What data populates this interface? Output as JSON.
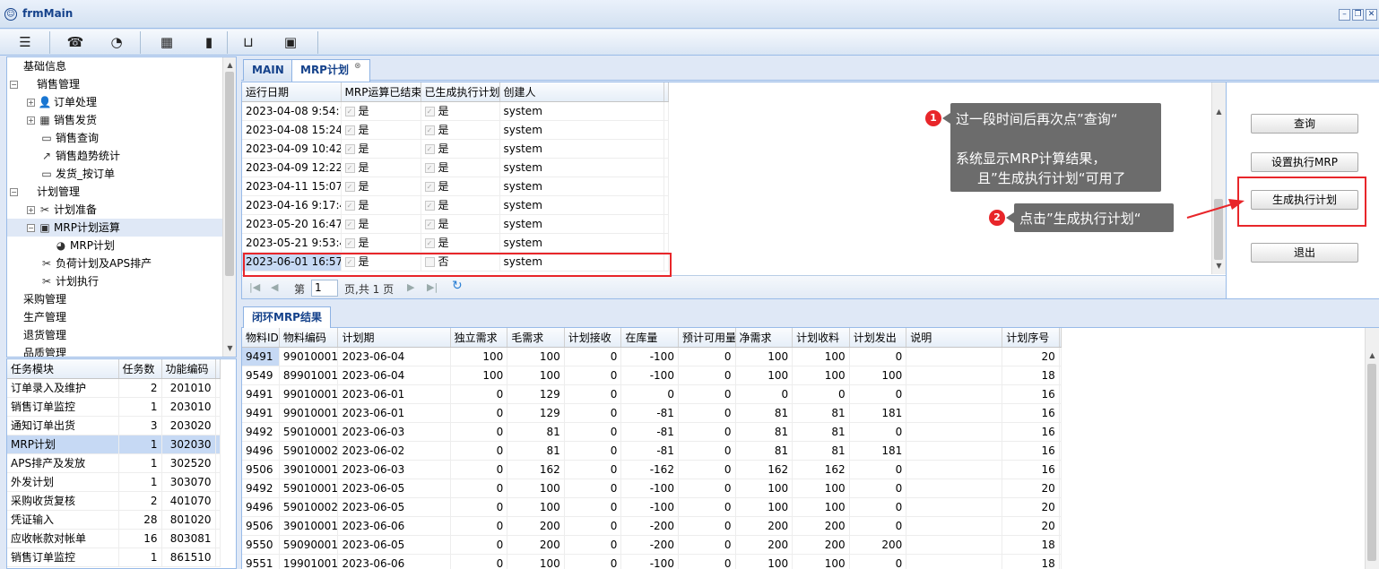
{
  "window": {
    "title": "frmMain",
    "controls": [
      "minimize-button",
      "restore-button",
      "close-button"
    ]
  },
  "toolbar": {
    "icons": [
      "menu-icon",
      "phone-icon",
      "rss-icon",
      "calendar-icon",
      "bookmark-icon",
      "inbox-icon",
      "image-icon"
    ]
  },
  "tree": {
    "items": [
      {
        "label": "基础信息",
        "indent": 0,
        "toggle": "",
        "icon": ""
      },
      {
        "label": "销售管理",
        "indent": 0,
        "toggle": "⊟",
        "icon": ""
      },
      {
        "label": "订单处理",
        "indent": 1,
        "toggle": "⊞",
        "icon": "user-icon"
      },
      {
        "label": "销售发货",
        "indent": 1,
        "toggle": "⊞",
        "icon": "calendar-icon"
      },
      {
        "label": "销售查询",
        "indent": 1,
        "toggle": "",
        "icon": "monitor-icon"
      },
      {
        "label": "销售趋势统计",
        "indent": 1,
        "toggle": "",
        "icon": "trend-icon"
      },
      {
        "label": "发货_按订单",
        "indent": 1,
        "toggle": "",
        "icon": "monitor-icon"
      },
      {
        "label": "计划管理",
        "indent": 0,
        "toggle": "⊟",
        "icon": ""
      },
      {
        "label": "计划准备",
        "indent": 1,
        "toggle": "⊞",
        "icon": "scissors-icon"
      },
      {
        "label": "MRP计划运算",
        "indent": 1,
        "toggle": "⊟",
        "icon": "image-icon"
      },
      {
        "label": "MRP计划",
        "indent": 2,
        "toggle": "",
        "icon": "pie-icon"
      },
      {
        "label": "负荷计划及APS排产",
        "indent": 1,
        "toggle": "",
        "icon": "scissors-icon"
      },
      {
        "label": "计划执行",
        "indent": 1,
        "toggle": "",
        "icon": "scissors-icon"
      },
      {
        "label": "采购管理",
        "indent": 0,
        "toggle": "",
        "icon": ""
      },
      {
        "label": "生产管理",
        "indent": 0,
        "toggle": "",
        "icon": ""
      },
      {
        "label": "退货管理",
        "indent": 0,
        "toggle": "",
        "icon": ""
      },
      {
        "label": "品质管理",
        "indent": 0,
        "toggle": "",
        "icon": ""
      }
    ],
    "selected_index": 9
  },
  "tasks": {
    "headers": [
      "任务模块",
      "任务数",
      "功能编码"
    ],
    "rows": [
      [
        "订单录入及维护",
        "2",
        "201010"
      ],
      [
        "销售订单监控",
        "1",
        "203010"
      ],
      [
        "通知订单出货",
        "3",
        "203020"
      ],
      [
        "MRP计划",
        "1",
        "302030"
      ],
      [
        "APS排产及发放",
        "1",
        "302520"
      ],
      [
        "外发计划",
        "1",
        "303070"
      ],
      [
        "采购收货复核",
        "2",
        "401070"
      ],
      [
        "凭证输入",
        "28",
        "801020"
      ],
      [
        "应收帐款对帐单",
        "16",
        "803081"
      ],
      [
        "销售订单监控",
        "1",
        "861510"
      ]
    ],
    "selected_index": 3
  },
  "tabs": [
    {
      "label": "MAIN",
      "closable": false
    },
    {
      "label": "MRP计划",
      "closable": true
    }
  ],
  "mrp_runs": {
    "headers": [
      "运行日期",
      "MRP运算已结束",
      "已生成执行计划",
      "创建人"
    ],
    "rows": [
      [
        "2023-04-08 9:54:13",
        "是",
        "是",
        "system"
      ],
      [
        "2023-04-08 15:24:5",
        "是",
        "是",
        "system"
      ],
      [
        "2023-04-09 10:42:2",
        "是",
        "是",
        "system"
      ],
      [
        "2023-04-09 12:22:5",
        "是",
        "是",
        "system"
      ],
      [
        "2023-04-11 15:07:2",
        "是",
        "是",
        "system"
      ],
      [
        "2023-04-16 9:17:46",
        "是",
        "是",
        "system"
      ],
      [
        "2023-05-20 16:47:4",
        "是",
        "是",
        "system"
      ],
      [
        "2023-05-21 9:53:48",
        "是",
        "是",
        "system"
      ],
      [
        "2023-06-01 16:57:2",
        "是",
        "否",
        "system"
      ]
    ],
    "checked": [
      [
        true,
        true
      ],
      [
        true,
        true
      ],
      [
        true,
        true
      ],
      [
        true,
        true
      ],
      [
        true,
        true
      ],
      [
        true,
        true
      ],
      [
        true,
        true
      ],
      [
        true,
        true
      ],
      [
        true,
        false
      ]
    ],
    "selected_index": 8
  },
  "pager": {
    "page_label": "第",
    "page_value": "1",
    "of_label": "页,共 1 页"
  },
  "actions": {
    "query": "查询",
    "set_mrp": "设置执行MRP",
    "generate": "生成执行计划",
    "exit": "退出"
  },
  "bottom_tab": {
    "label": "闭环MRP结果"
  },
  "mrp_results": {
    "headers": [
      "物料ID",
      "物料编码",
      "计划期",
      "独立需求",
      "毛需求",
      "计划接收",
      "在库量",
      "预计可用量",
      "净需求",
      "计划收料",
      "计划发出",
      "说明",
      "计划序号"
    ],
    "rows": [
      [
        "9491",
        "99010001",
        "2023-06-04",
        "100",
        "100",
        "0",
        "-100",
        "0",
        "100",
        "100",
        "0",
        "",
        "20"
      ],
      [
        "9549",
        "89901001",
        "2023-06-04",
        "100",
        "100",
        "0",
        "-100",
        "0",
        "100",
        "100",
        "100",
        "",
        "18"
      ],
      [
        "9491",
        "99010001",
        "2023-06-01",
        "0",
        "129",
        "0",
        "0",
        "0",
        "0",
        "0",
        "0",
        "",
        "16"
      ],
      [
        "9491",
        "99010001",
        "2023-06-01",
        "0",
        "129",
        "0",
        "-81",
        "0",
        "81",
        "81",
        "181",
        "",
        "16"
      ],
      [
        "9492",
        "59010001",
        "2023-06-03",
        "0",
        "81",
        "0",
        "-81",
        "0",
        "81",
        "81",
        "0",
        "",
        "16"
      ],
      [
        "9496",
        "59010002",
        "2023-06-02",
        "0",
        "81",
        "0",
        "-81",
        "0",
        "81",
        "81",
        "181",
        "",
        "16"
      ],
      [
        "9506",
        "39010001",
        "2023-06-03",
        "0",
        "162",
        "0",
        "-162",
        "0",
        "162",
        "162",
        "0",
        "",
        "16"
      ],
      [
        "9492",
        "59010001",
        "2023-06-05",
        "0",
        "100",
        "0",
        "-100",
        "0",
        "100",
        "100",
        "0",
        "",
        "20"
      ],
      [
        "9496",
        "59010002",
        "2023-06-05",
        "0",
        "100",
        "0",
        "-100",
        "0",
        "100",
        "100",
        "0",
        "",
        "20"
      ],
      [
        "9506",
        "39010001",
        "2023-06-06",
        "0",
        "200",
        "0",
        "-200",
        "0",
        "200",
        "200",
        "0",
        "",
        "20"
      ],
      [
        "9550",
        "59090001",
        "2023-06-05",
        "0",
        "200",
        "0",
        "-200",
        "0",
        "200",
        "200",
        "200",
        "",
        "18"
      ],
      [
        "9551",
        "19901001",
        "2023-06-06",
        "0",
        "100",
        "0",
        "-100",
        "0",
        "100",
        "100",
        "0",
        "",
        "18"
      ]
    ]
  },
  "annotations": {
    "callout1": {
      "badge": "1",
      "line1": "过一段时间后再次点”查询“",
      "line2": "系统显示MRP计算结果，",
      "line3": "且”生成执行计划“可用了"
    },
    "callout2": {
      "badge": "2",
      "text": "点击”生成执行计划“"
    },
    "accent_color": "#e8262a"
  }
}
